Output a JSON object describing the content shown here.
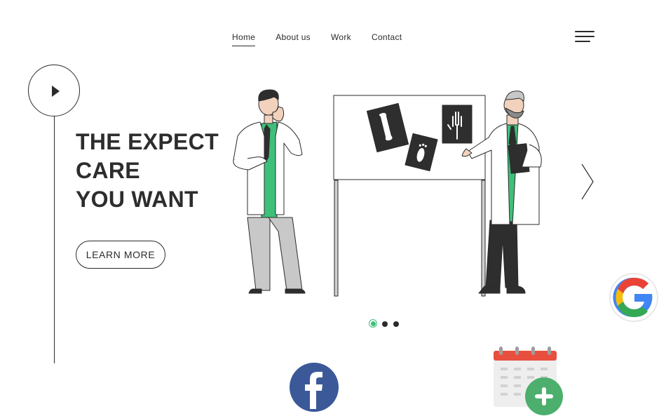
{
  "nav": {
    "items": [
      {
        "label": "Home",
        "active": true
      },
      {
        "label": "About us",
        "active": false
      },
      {
        "label": "Work",
        "active": false
      },
      {
        "label": "Contact",
        "active": false
      }
    ],
    "menu_icon": "hamburger-icon"
  },
  "hero": {
    "headline_lines": [
      "THE EXPECT",
      "CARE",
      "YOU WANT"
    ],
    "cta_label": "LEARN MORE",
    "play_icon": "play-icon"
  },
  "slider": {
    "next_icon": "chevron-right-icon",
    "dots_count": 3,
    "active_dot": 0
  },
  "floating_icons": [
    "google-icon",
    "facebook-icon",
    "calendar-add-icon"
  ],
  "colors": {
    "text": "#2b2b2b",
    "accent_green": "#3ec07a",
    "google_blue": "#4285F4",
    "google_red": "#EA4335",
    "google_yellow": "#FBBC05",
    "google_green": "#34A853",
    "facebook_blue": "#3b5998",
    "calendar_red": "#e84f3f",
    "plus_green": "#4caf6d"
  }
}
